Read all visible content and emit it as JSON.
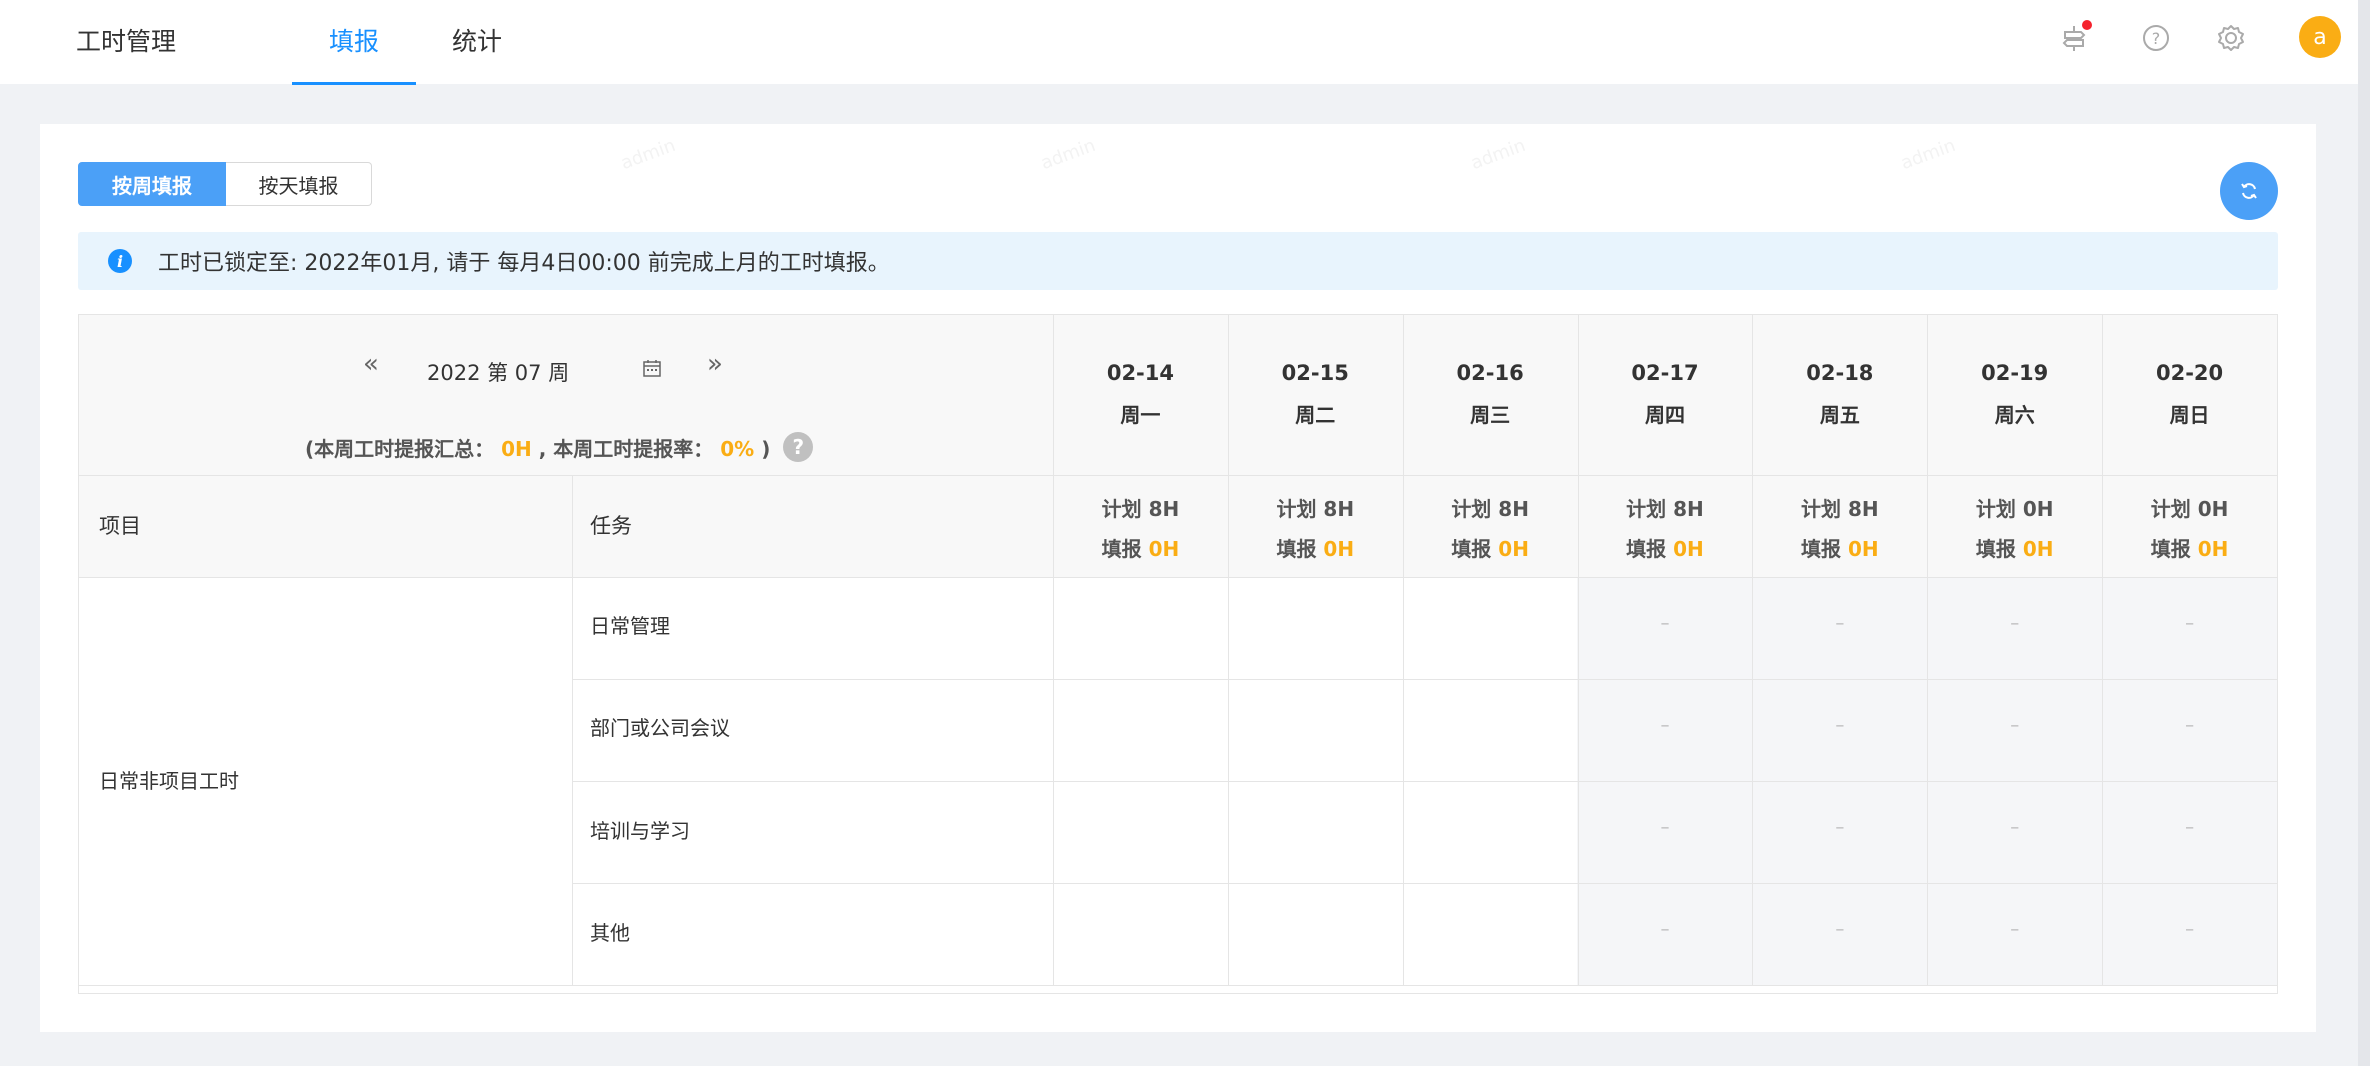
{
  "app": {
    "title": "工时管理"
  },
  "tabs": [
    {
      "label": "填报",
      "active": true
    },
    {
      "label": "统计",
      "active": false
    }
  ],
  "header_icons": [
    "notification-icon",
    "help-icon",
    "settings-icon"
  ],
  "user": {
    "avatar_letter": "a"
  },
  "mode_switch": {
    "weekly": "按周填报",
    "daily": "按天填报",
    "active": "weekly"
  },
  "alert": {
    "text": "工时已锁定至: 2022年01月, 请于 每月4日00:00 前完成上月的工时填报。"
  },
  "week_nav": {
    "label": "2022 第 07 周",
    "prev": "«",
    "next": "»"
  },
  "summary": {
    "prefix": "(本周工时提报汇总：",
    "total": "0H",
    "middle": ", 本周工时提报率：",
    "rate": "0%",
    "suffix": ")",
    "help": "?"
  },
  "columns": {
    "project": "项目",
    "task": "任务"
  },
  "days": [
    {
      "date": "02-14",
      "weekday": "周一",
      "plan_label": "计划",
      "plan": "8H",
      "fill_label": "填报",
      "fill": "0H",
      "editable": true
    },
    {
      "date": "02-15",
      "weekday": "周二",
      "plan_label": "计划",
      "plan": "8H",
      "fill_label": "填报",
      "fill": "0H",
      "editable": true
    },
    {
      "date": "02-16",
      "weekday": "周三",
      "plan_label": "计划",
      "plan": "8H",
      "fill_label": "填报",
      "fill": "0H",
      "editable": true
    },
    {
      "date": "02-17",
      "weekday": "周四",
      "plan_label": "计划",
      "plan": "8H",
      "fill_label": "填报",
      "fill": "0H",
      "editable": false
    },
    {
      "date": "02-18",
      "weekday": "周五",
      "plan_label": "计划",
      "plan": "8H",
      "fill_label": "填报",
      "fill": "0H",
      "editable": false
    },
    {
      "date": "02-19",
      "weekday": "周六",
      "plan_label": "计划",
      "plan": "0H",
      "fill_label": "填报",
      "fill": "0H",
      "editable": false
    },
    {
      "date": "02-20",
      "weekday": "周日",
      "plan_label": "计划",
      "plan": "0H",
      "fill_label": "填报",
      "fill": "0H",
      "editable": false
    }
  ],
  "project": {
    "name": "日常非项目工时",
    "tasks": [
      "日常管理",
      "部门或公司会议",
      "培训与学习",
      "其他"
    ]
  },
  "disabled_cell_text": "–",
  "watermark": "admin",
  "colors": {
    "primary": "#1890ff",
    "button": "#4ba0f7",
    "accent": "#faad14",
    "alert_bg": "#e8f4fd"
  }
}
